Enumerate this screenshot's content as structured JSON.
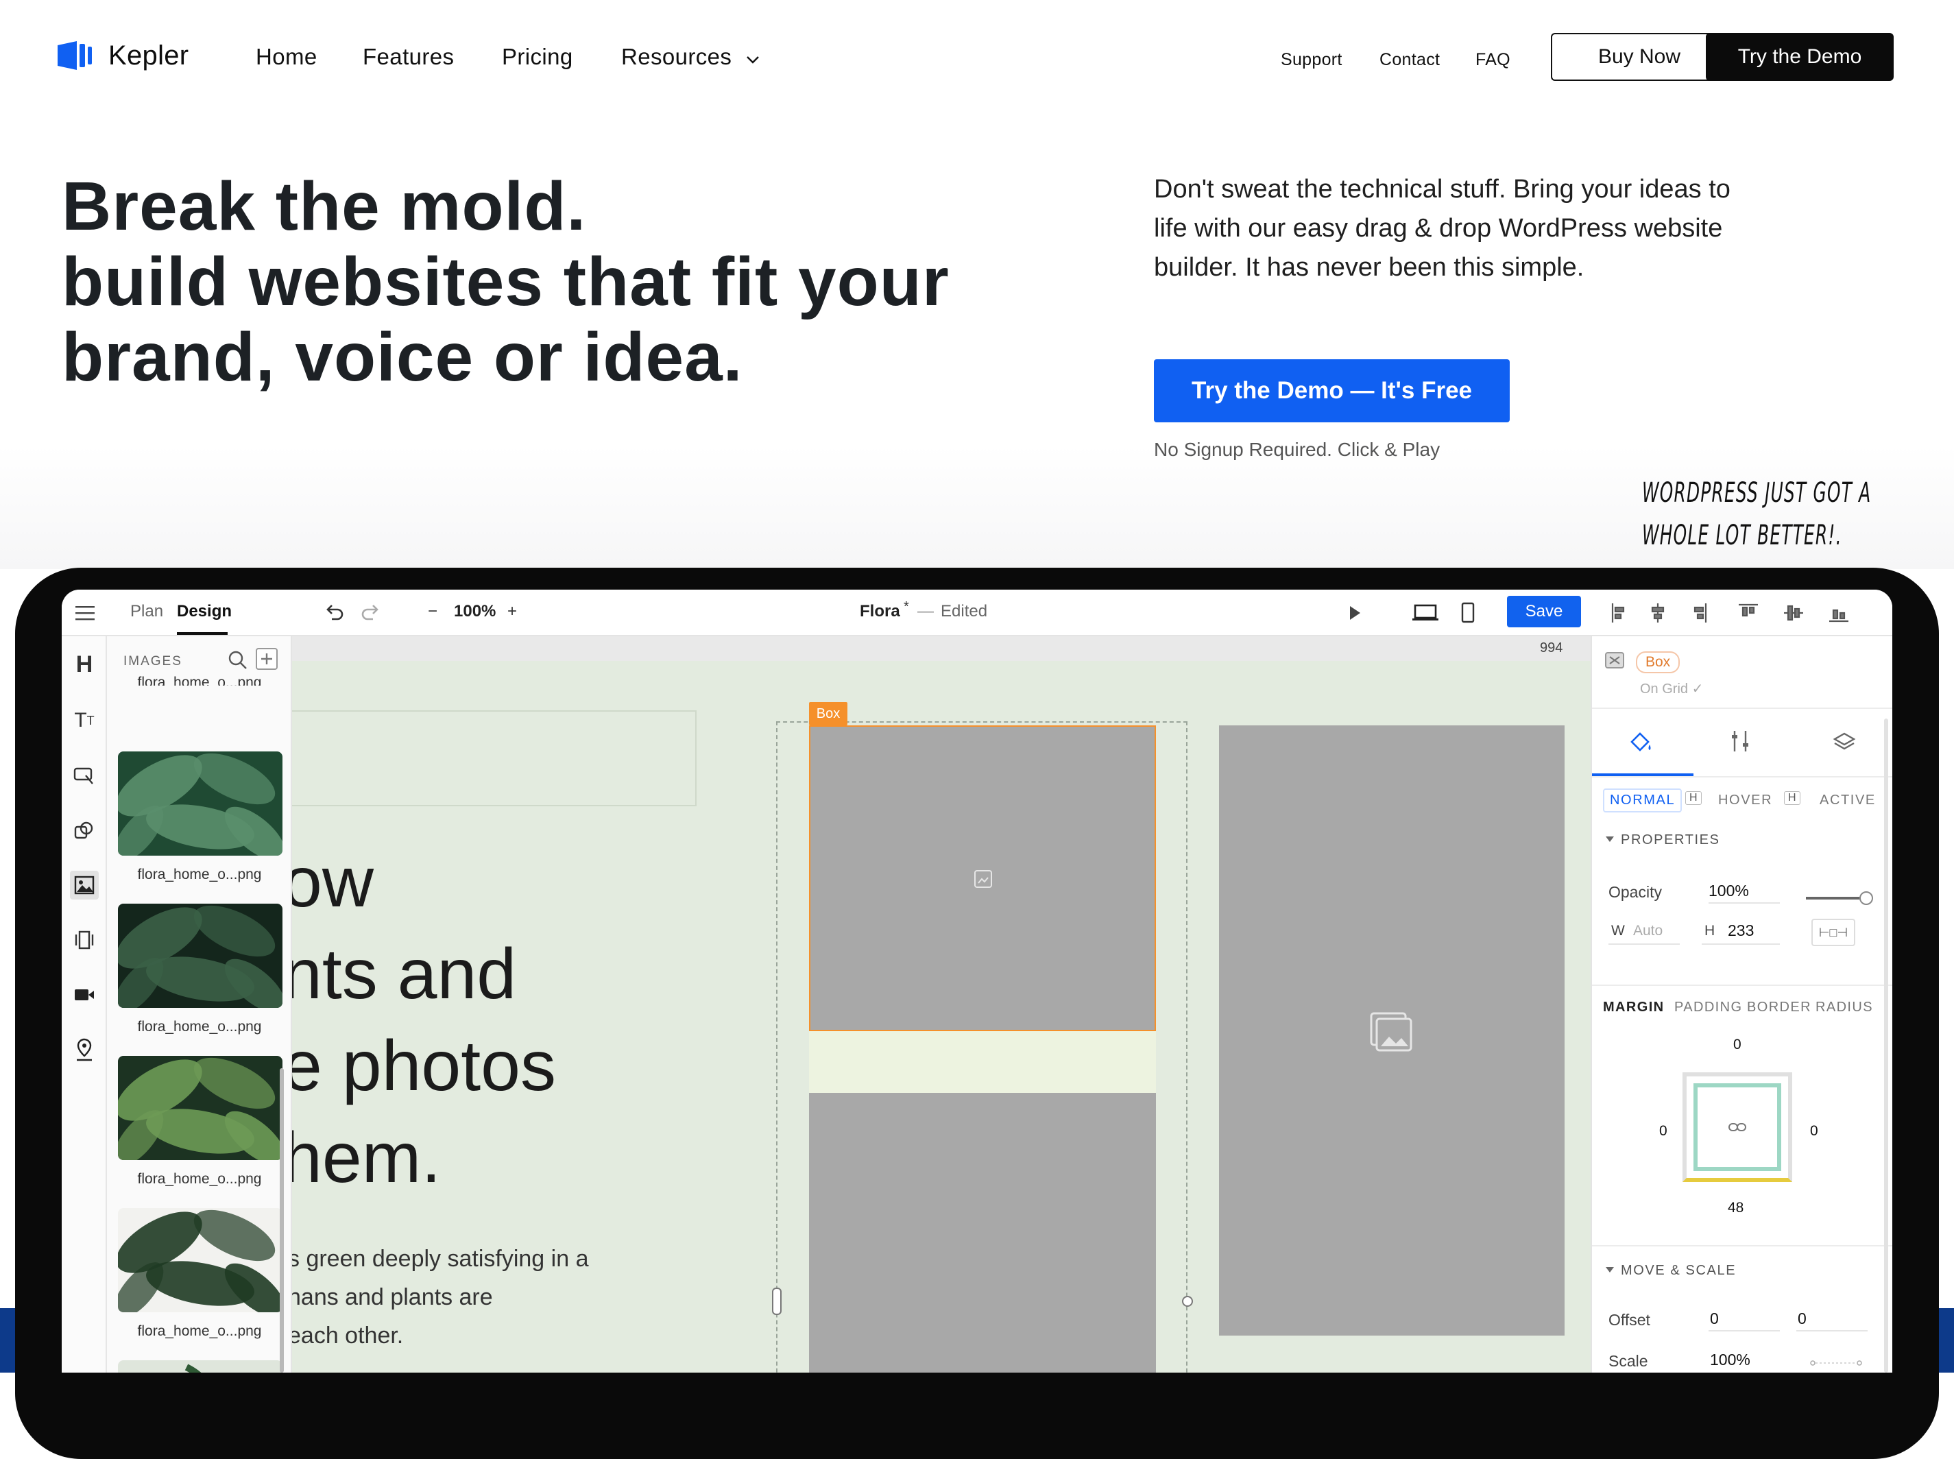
{
  "site": {
    "brand": "Kepler",
    "nav": [
      "Home",
      "Features",
      "Pricing",
      "Resources"
    ],
    "secondary_nav": [
      "Support",
      "Contact",
      "FAQ"
    ],
    "buy_label": "Buy Now",
    "demo_label": "Try the Demo"
  },
  "hero": {
    "title_lines": [
      "Break the mold.",
      "build websites that fit your",
      "brand, voice or idea."
    ],
    "description": "Don't sweat the technical stuff. Bring your ideas to life with our easy drag & drop WordPress website builder. It has never been this simple.",
    "cta_label": "Try the Demo — It's Free",
    "note": "No Signup Required. Click & Play",
    "handwritten": [
      "WORDPRESS JUST GOT A",
      "WHOLE LOT BETTER!."
    ]
  },
  "editor": {
    "mode_tabs": [
      "Plan",
      "Design"
    ],
    "active_mode": "Design",
    "zoom": "100%",
    "doc_name": "Flora",
    "doc_status": "Edited",
    "save_label": "Save",
    "ruler_value": "994",
    "panel_title": "IMAGES",
    "images": [
      {
        "label": "flora_home_o...png",
        "color_a": "#1f4a33",
        "color_b": "#5a8f6c"
      },
      {
        "label": "flora_home_o...png",
        "color_a": "#14261c",
        "color_b": "#3b6147"
      },
      {
        "label": "flora_home_o...png",
        "color_a": "#1c3322",
        "color_b": "#6d9a55"
      },
      {
        "label": "flora_home_o...png",
        "color_a": "#f2f2ef",
        "color_b": "#1f3b24"
      }
    ],
    "partial_image_label": "flora_home_o...png",
    "canvas_text_lines": [
      "ow",
      "nts and",
      "e photos",
      "hem."
    ],
    "canvas_body_lines": [
      "s green deeply satisfying in a",
      "nans and plants are",
      "each other."
    ],
    "selected_tag": "Box",
    "right_panel": {
      "element": "Box",
      "on_grid": "On Grid ✓",
      "states": [
        "NORMAL",
        "HOVER",
        "ACTIVE"
      ],
      "properties_header": "PROPERTIES",
      "opacity_label": "Opacity",
      "opacity_value": "100%",
      "opacity_level": 1.0,
      "w_label": "W",
      "w_value": "Auto",
      "h_label": "H",
      "h_value": "233",
      "spacing_tabs": [
        "MARGIN",
        "PADDING",
        "BORDER",
        "RADIUS"
      ],
      "margin_top": "0",
      "margin_left": "0",
      "margin_right": "0",
      "margin_bottom": "48",
      "move_header": "MOVE & SCALE",
      "offset_label": "Offset",
      "offset_x": "0",
      "offset_y": "0",
      "scale_label": "Scale",
      "scale_value": "100%"
    }
  },
  "colors": {
    "accent_blue": "#1060f2",
    "select_orange": "#f5902b",
    "canvas_bg": "#e3ebdf",
    "margin_teal": "#9dd7c4",
    "margin_yellow": "#e6cb3e"
  }
}
